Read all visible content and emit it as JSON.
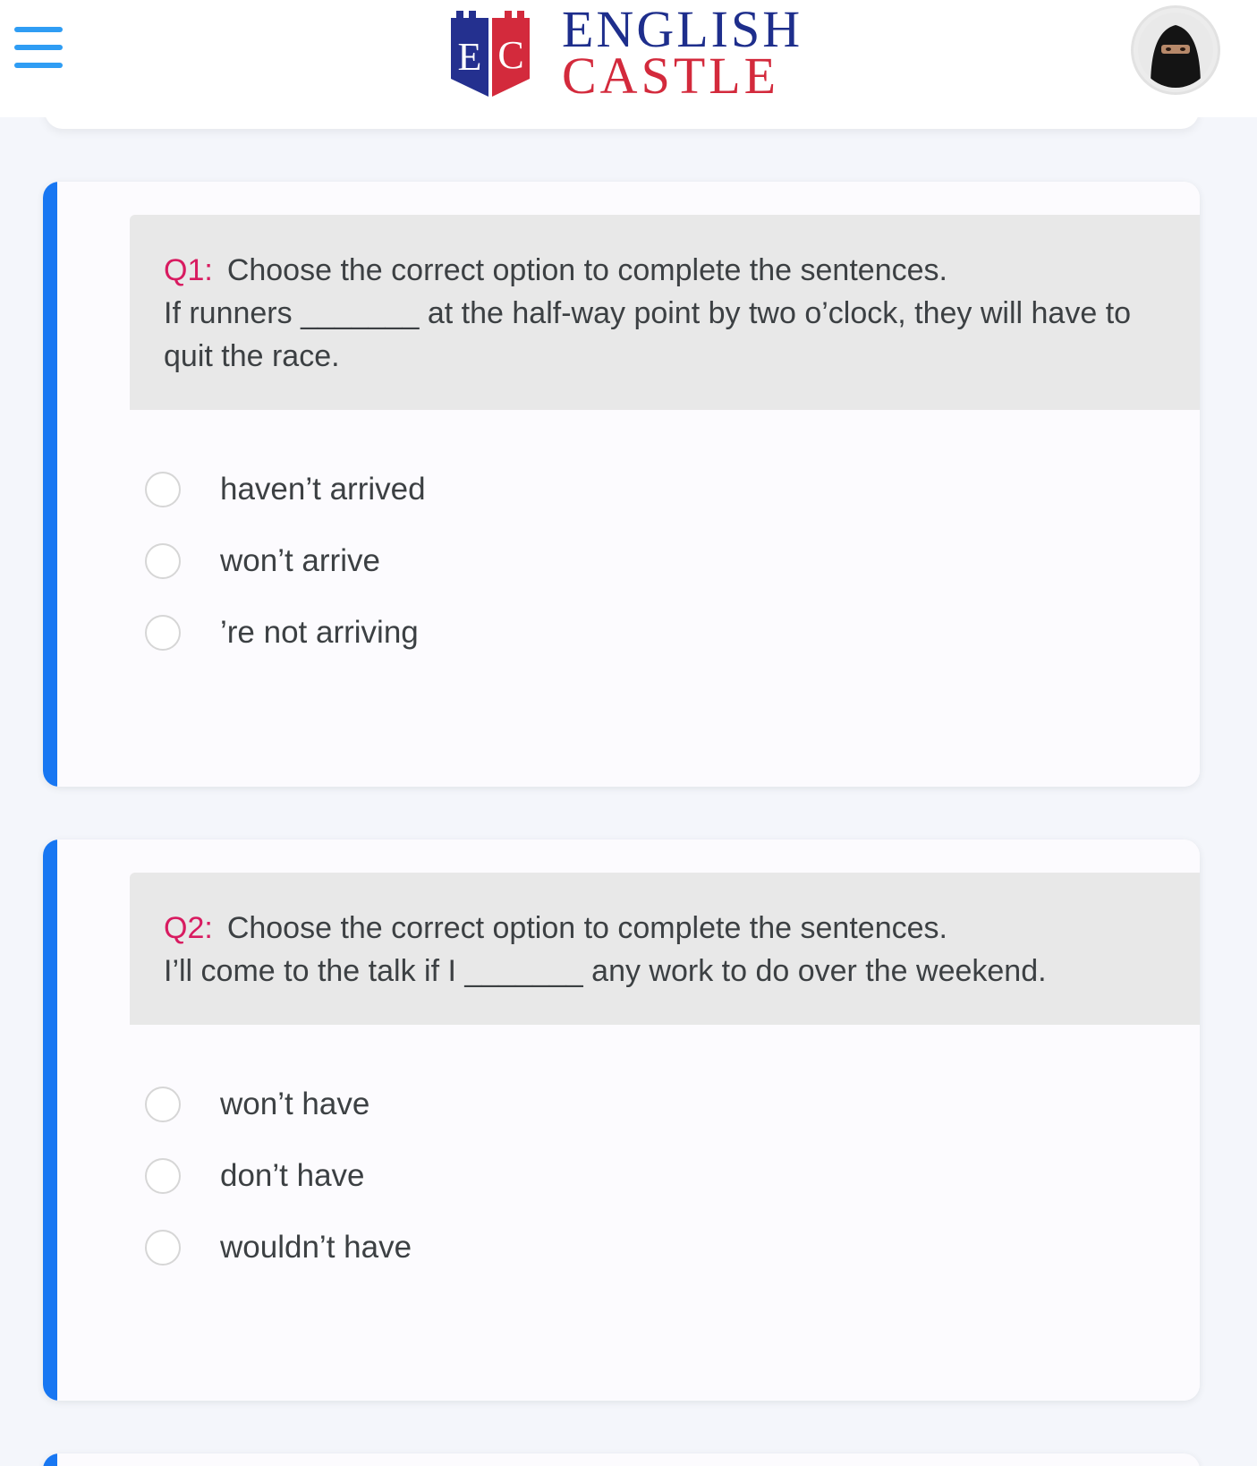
{
  "header": {
    "logo": {
      "monogram_left": "E",
      "monogram_right": "C",
      "line1": "ENGLISH",
      "line2": "CASTLE"
    },
    "menu_icon": "hamburger-menu-icon",
    "avatar_icon": "user-avatar"
  },
  "colors": {
    "accent": "#1877f2",
    "menu": "#2f9df4",
    "question_number": "#d81b60",
    "logo_blue": "#1e2e8c",
    "logo_red": "#d32a3c"
  },
  "questions": [
    {
      "number": "Q1:",
      "instruction": "Choose the correct option to complete the sentences.",
      "sentence_line1": "If runners _______ at the half-way point by two o’clock, they will have to",
      "sentence_line2": "quit the race.",
      "options": [
        "haven’t arrived",
        "won’t arrive",
        "’re not arriving"
      ]
    },
    {
      "number": "Q2:",
      "instruction": "Choose the correct option to complete the sentences.",
      "sentence_line1": "I’ll come to the talk if I _______ any work to do over the weekend.",
      "options": [
        "won’t have",
        "don’t have",
        "wouldn’t have"
      ]
    }
  ]
}
